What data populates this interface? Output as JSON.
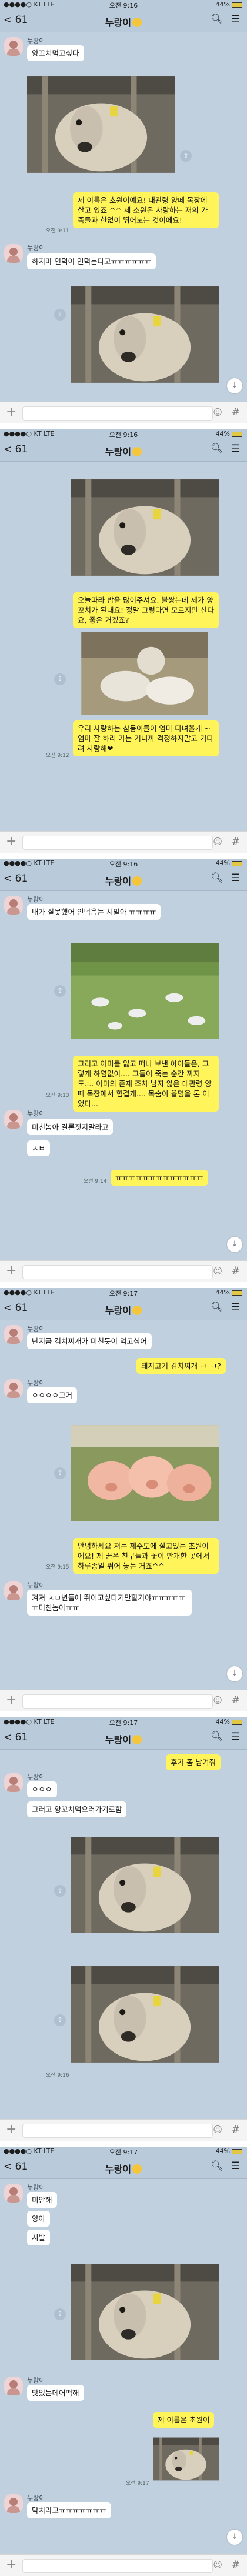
{
  "status": {
    "carrier": "●●●●○ KT  LTE",
    "time1": "오전 9:16",
    "time2": "오전 9:17",
    "battery": "44%"
  },
  "header": {
    "back": "< 61",
    "title": "누랑이",
    "search_icon": "search-icon",
    "menu_icon": "hamburger-menu-icon"
  },
  "input": {
    "plus": "+",
    "hash": "#",
    "smile": "☺"
  },
  "icons": {
    "share": "⇧",
    "down": "↓"
  },
  "s1": {
    "nick": "누랑이",
    "m1": "양꼬치먹고싶다",
    "m2": "제 이름은 초원이예요! 대관령 양떼 목장에 살고 있죠 ^^ 제 소원은 사랑하는 저의 가족들과 한없이 뛰어노는 것이에요!",
    "m3": "하지마 인덕이 인덕는다고ㅠㅠㅠㅠㅠㅠ",
    "t1": "오전 9:11",
    "t2": "오전 9:12"
  },
  "s2": {
    "m1": "오늘따라 밥을 많이주셔요. 불쌍는데 제가 양꼬치가 된대요! 정말 그렇다면 모르지만 산다요, 좋은 거겠죠?",
    "m2": "우리 사랑하는 삼동이들이 엄마 다녀올게 ~ 엄마 잘 하러 가는 거니까 걱정하지말고 기다려 사랑해❤",
    "t1": "오전 9:12"
  },
  "s3": {
    "nick": "누랑이",
    "m1": "내가 잘못했어 인덕음는 시발아 ㅠㅠㅠㅠ",
    "m2": "그리고 어미를 잃고 떠나 보낸 아이들은, 그렇게 하염없이.... 그들이 죽는 순간 까지도.... 어미의 존재 조차 남지 않은 대관령 양떼 목장에서 힘겹게.... 목숨이 율명을 톤 이었다...",
    "m3": "미친놈아 결론짓지말라고",
    "m4": "ㅅㅂ",
    "m5": "ㅠㅠㅠㅠㅠㅠㅠㅠㅠㅠㅠㅠㅠ",
    "t1": "오전 9:13",
    "t2": "오전 9:14"
  },
  "s4": {
    "nick": "누랑이",
    "m1": "난지금 김치찌개가 미친듯이 먹고싶어",
    "m2": "돼지고기 김치찌개 ㅋ_ㅋ?",
    "m3": "ㅇㅇㅇㅇ그거",
    "m4": "안녕하세요 저는 제주도에 살고있는 초원이에요! 제 꿈은 친구들과 꽃이 만개한 곳에서 하루종일 뛰어 놓는 거죠^^",
    "m5": "겨져 ㅅㅂ년들에 뛰어고싶다기만할거야ㅠㅠㅠㅠㅠㅠ미친놈아ㅠㅠ",
    "t1": "오전 9:15"
  },
  "s5": {
    "nick": "누랑이",
    "m1": "후기 좀 남겨줘",
    "m2": "ㅇㅇㅇ",
    "m3": "그러고 양꼬치먹으러가기로함",
    "t1": "오전 9:16"
  },
  "s6": {
    "nick": "누랑이",
    "m1": "미안해",
    "m2": "양아",
    "m3": "시발",
    "m4": "맛있는데어떡해",
    "m5": "제 이름은 초원이",
    "m6": "닥치라고ㅠㅠㅠㅠㅠㅠㅠ",
    "t1": "오전 9:17"
  }
}
